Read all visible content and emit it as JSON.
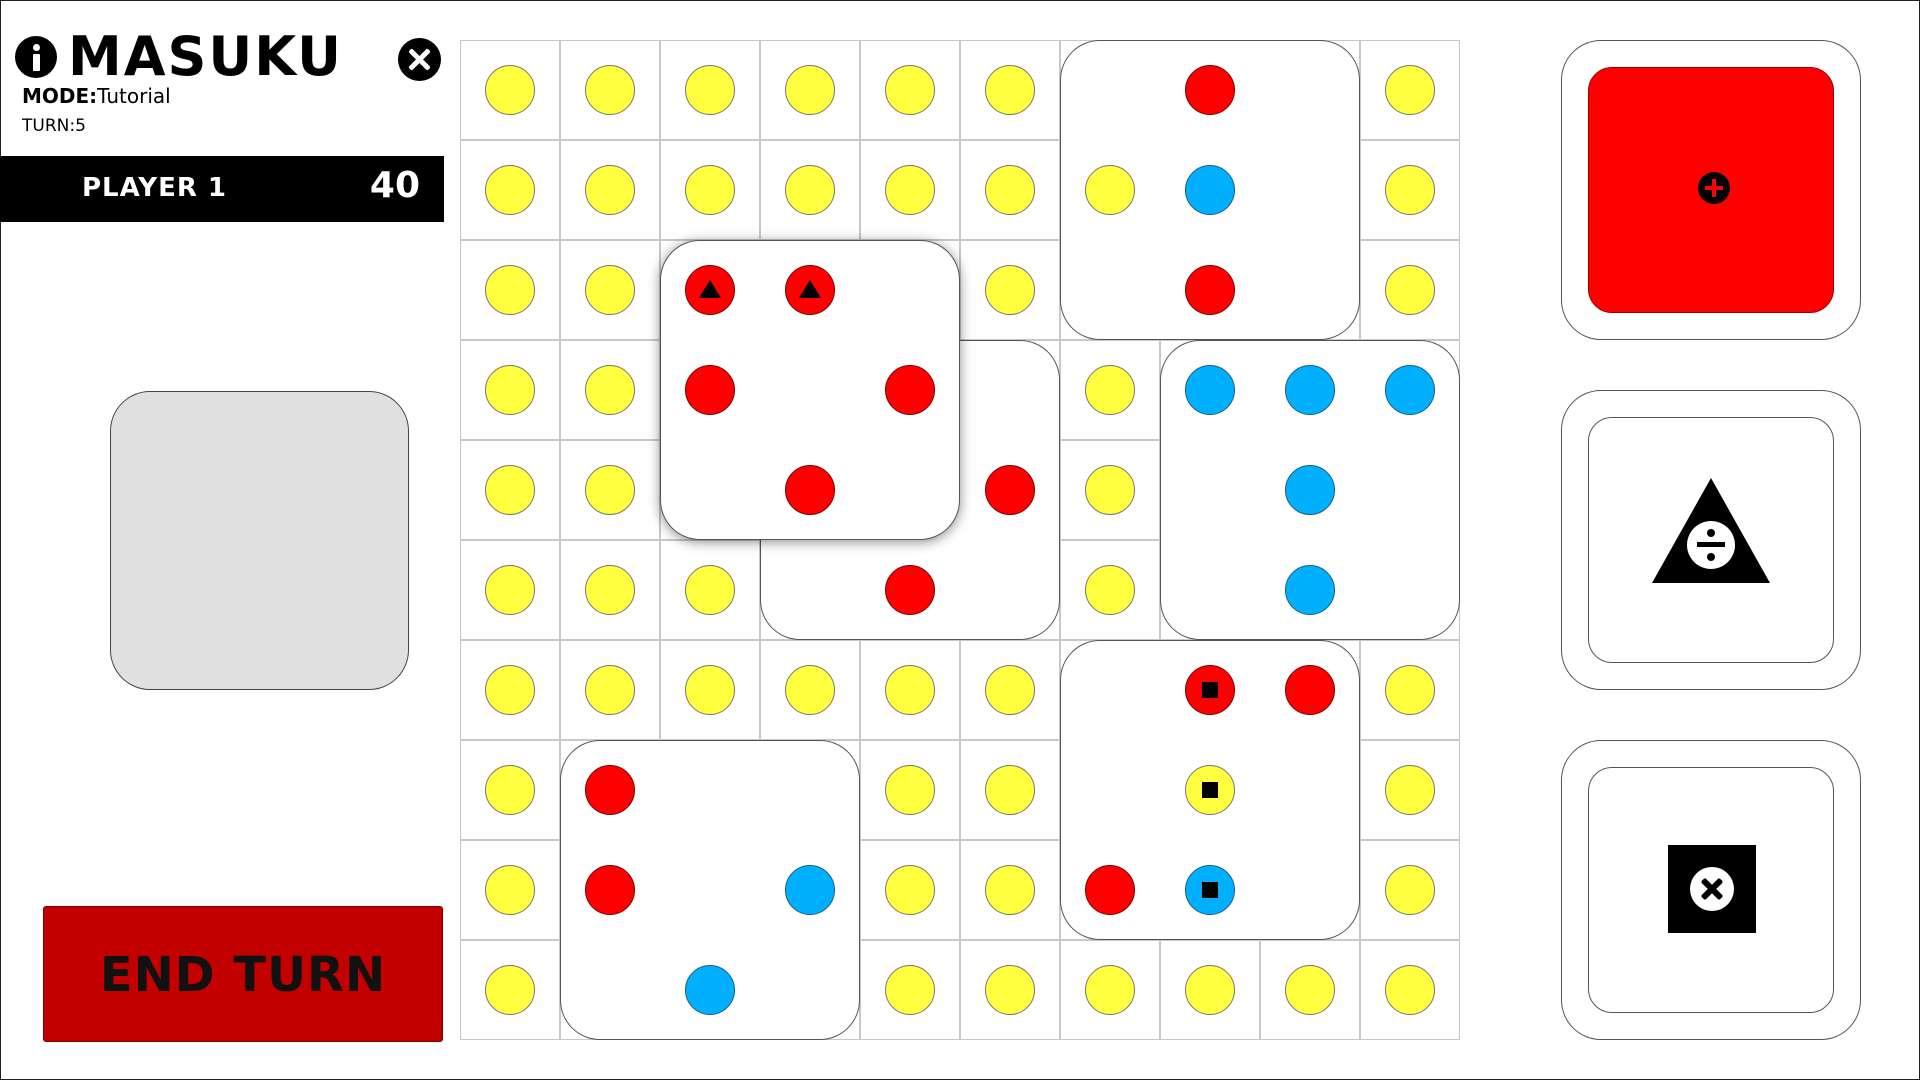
{
  "app": {
    "title": "MASUKU",
    "mode_label": "MODE:",
    "mode_value": "Tutorial",
    "turn_label": "TURN:",
    "turn_value": "5"
  },
  "player": {
    "name": "PLAYER 1",
    "score": "40"
  },
  "end_turn": {
    "label": "END TURN"
  },
  "colors": {
    "yellow": "#ffff40",
    "red": "#ff0000",
    "blue": "#00b0ff",
    "end_turn": "#c20000"
  },
  "icons": {
    "info": "info-icon",
    "close": "close-icon",
    "add": "plus-circle-icon",
    "divide": "triangle-divide-icon",
    "discard": "x-box-icon"
  },
  "board": {
    "columns": 10,
    "rows": 10,
    "background_cell_dot": "yellow",
    "tiles": [
      {
        "id": "tile-a",
        "col": 6,
        "row": 0,
        "dots": [
          {
            "c": 1,
            "r": 0,
            "color": "red"
          },
          {
            "c": 0,
            "r": 1,
            "color": "yellow"
          },
          {
            "c": 1,
            "r": 1,
            "color": "blue"
          },
          {
            "c": 1,
            "r": 2,
            "color": "red"
          }
        ]
      },
      {
        "id": "tile-b",
        "col": 3,
        "row": 3,
        "dots": [
          {
            "c": 2,
            "r": 1,
            "color": "red"
          },
          {
            "c": 1,
            "r": 2,
            "color": "red"
          }
        ]
      },
      {
        "id": "tile-c",
        "col": 2,
        "row": 2,
        "shadow": true,
        "dots": [
          {
            "c": 0,
            "r": 0,
            "color": "red",
            "symbol": "triangle"
          },
          {
            "c": 1,
            "r": 0,
            "color": "red",
            "symbol": "triangle"
          },
          {
            "c": 0,
            "r": 1,
            "color": "red"
          },
          {
            "c": 2,
            "r": 1,
            "color": "red"
          },
          {
            "c": 1,
            "r": 2,
            "color": "red"
          }
        ]
      },
      {
        "id": "tile-d",
        "col": 7,
        "row": 3,
        "dots": [
          {
            "c": 0,
            "r": 0,
            "color": "blue"
          },
          {
            "c": 1,
            "r": 0,
            "color": "blue"
          },
          {
            "c": 2,
            "r": 0,
            "color": "blue"
          },
          {
            "c": 1,
            "r": 1,
            "color": "blue"
          },
          {
            "c": 1,
            "r": 2,
            "color": "blue"
          }
        ]
      },
      {
        "id": "tile-e",
        "col": 6,
        "row": 6,
        "dots": [
          {
            "c": 1,
            "r": 0,
            "color": "red",
            "symbol": "square"
          },
          {
            "c": 2,
            "r": 0,
            "color": "red"
          },
          {
            "c": 1,
            "r": 1,
            "color": "yellow",
            "symbol": "square"
          },
          {
            "c": 0,
            "r": 2,
            "color": "red"
          },
          {
            "c": 1,
            "r": 2,
            "color": "blue",
            "symbol": "square"
          }
        ]
      },
      {
        "id": "tile-f",
        "col": 1,
        "row": 7,
        "dots": [
          {
            "c": 0,
            "r": 0,
            "color": "red"
          },
          {
            "c": 0,
            "r": 1,
            "color": "red"
          },
          {
            "c": 2,
            "r": 1,
            "color": "blue"
          },
          {
            "c": 1,
            "r": 2,
            "color": "blue"
          }
        ]
      }
    ]
  }
}
